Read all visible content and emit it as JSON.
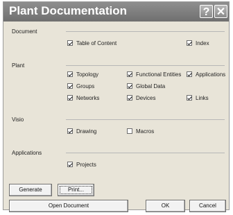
{
  "window": {
    "title": "Plant Documentation",
    "help_glyph": "?",
    "close_glyph": "✕"
  },
  "sections": {
    "document": "Document",
    "plant": "Plant",
    "visio": "Visio",
    "applications": "Applications"
  },
  "checkboxes": {
    "table_of_content": {
      "label": "Table of Content",
      "checked": true
    },
    "index": {
      "label": "Index",
      "checked": true
    },
    "topology": {
      "label": "Topology",
      "checked": true
    },
    "functional_entities": {
      "label": "Functional Entities",
      "checked": true
    },
    "applications": {
      "label": "Applications",
      "checked": true
    },
    "groups": {
      "label": "Groups",
      "checked": true
    },
    "global_data": {
      "label": "Global Data",
      "checked": true
    },
    "networks": {
      "label": "Networks",
      "checked": true
    },
    "devices": {
      "label": "Devices",
      "checked": true
    },
    "links": {
      "label": "Links",
      "checked": true
    },
    "drawing": {
      "label": "Drawing",
      "checked": true
    },
    "macros": {
      "label": "Macros",
      "checked": false
    },
    "projects": {
      "label": "Projects",
      "checked": true
    }
  },
  "buttons": {
    "generate": "Generate",
    "print": "Print...",
    "open_document": "Open Document",
    "ok": "OK",
    "cancel": "Cancel"
  }
}
